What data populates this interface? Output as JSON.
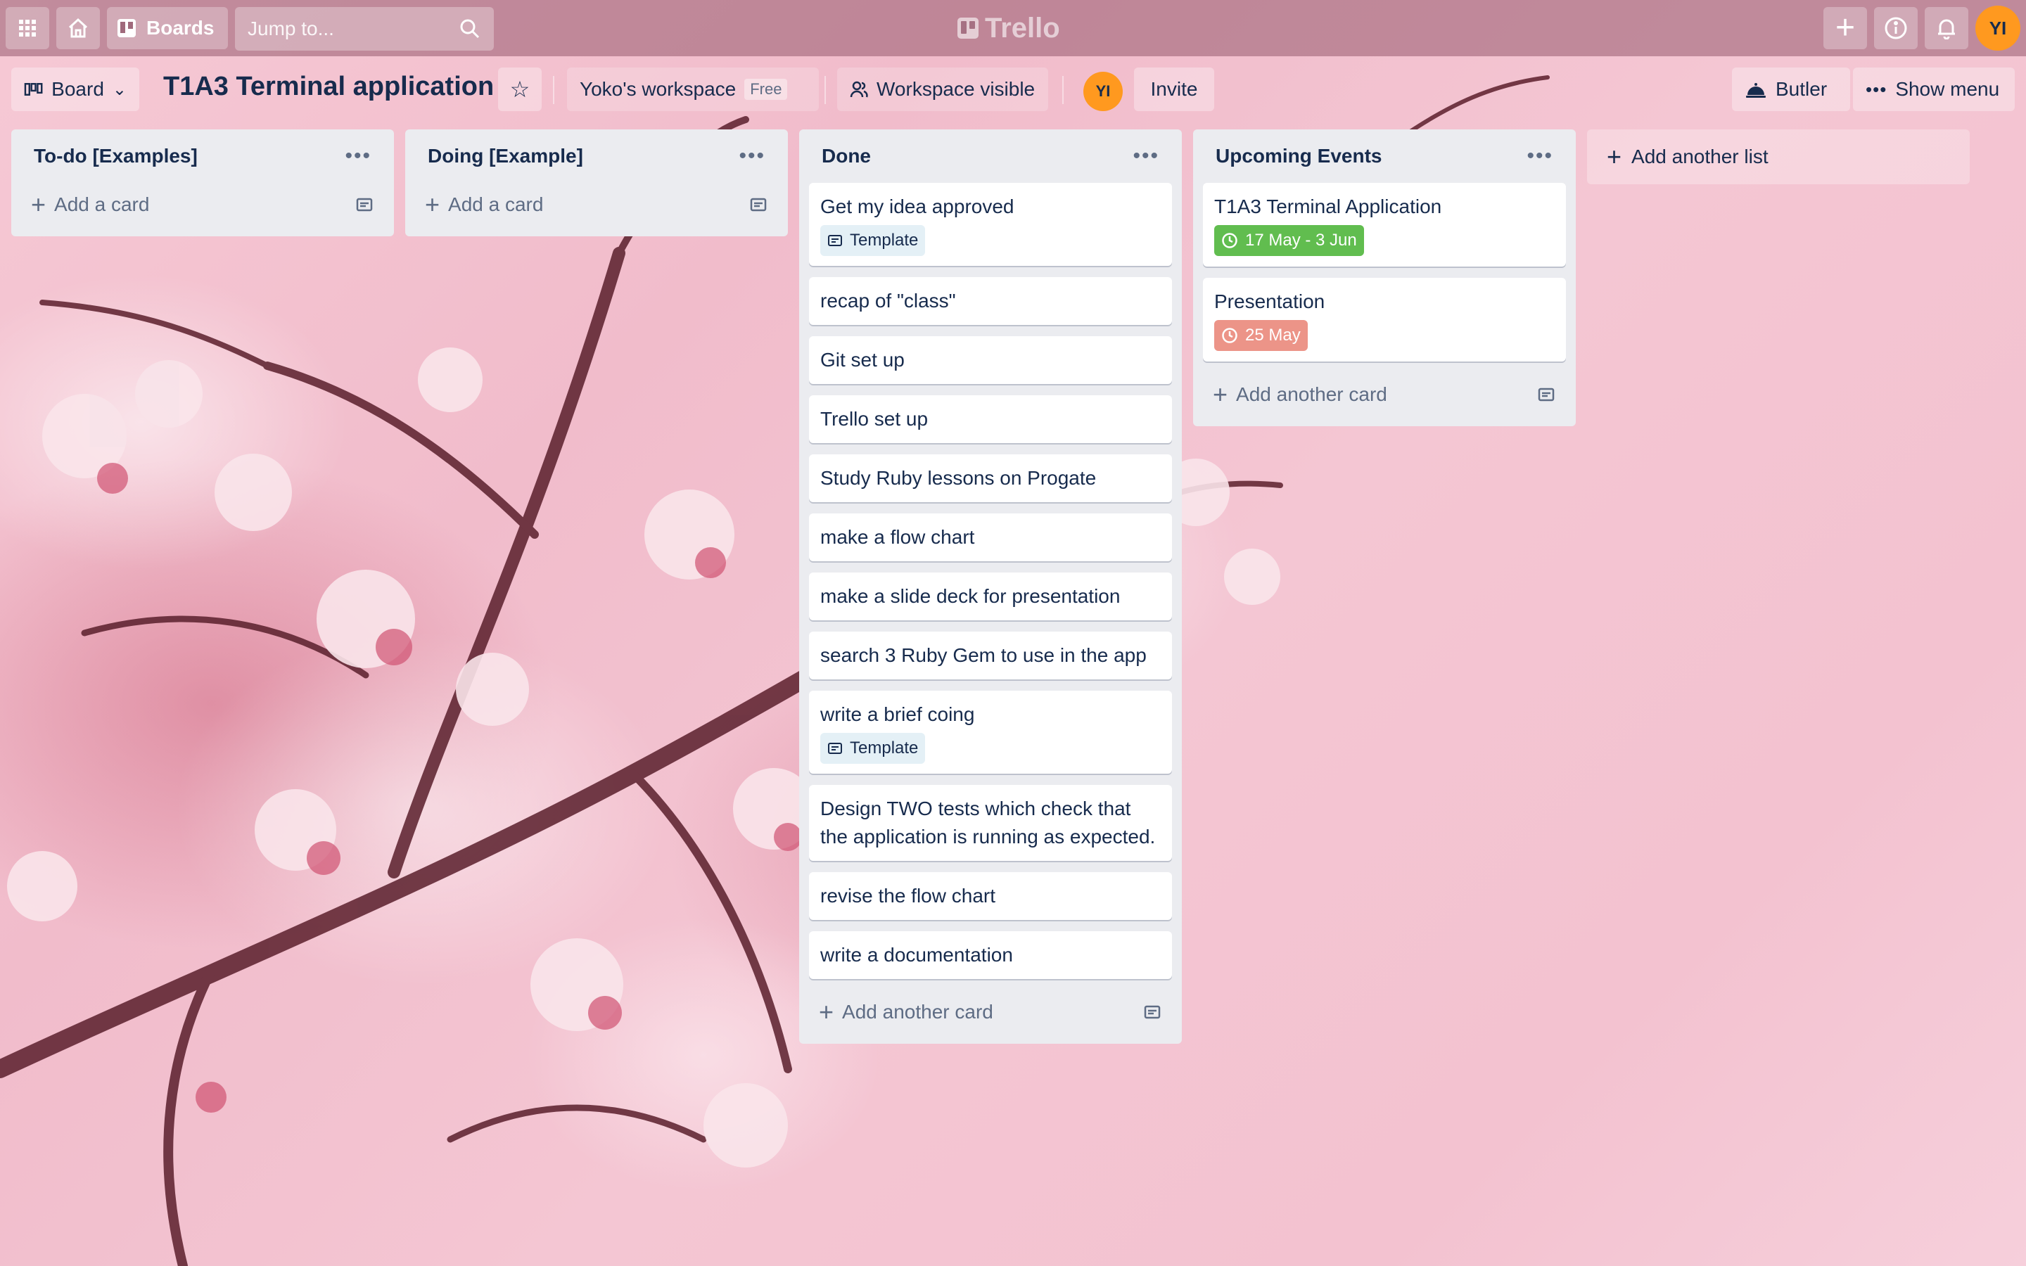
{
  "topbar": {
    "boards_label": "Boards",
    "search_placeholder": "Jump to...",
    "logo_text": "Trello",
    "user_initials": "YI"
  },
  "board": {
    "view_label": "Board",
    "title": "T1A3 Terminal application",
    "workspace_name": "Yoko's workspace",
    "workspace_plan": "Free",
    "visibility_label": "Workspace visible",
    "member_initials": "YI",
    "invite_label": "Invite",
    "butler_label": "Butler",
    "show_menu_label": "Show menu"
  },
  "lists": [
    {
      "title": "To-do [Examples]",
      "cards": [],
      "add_label": "Add a card"
    },
    {
      "title": "Doing [Example]",
      "cards": [],
      "add_label": "Add a card"
    },
    {
      "title": "Done",
      "cards": [
        {
          "title": "Get my idea approved",
          "badge": "Template"
        },
        {
          "title": "recap of \"class\""
        },
        {
          "title": "Git set up"
        },
        {
          "title": "Trello set up"
        },
        {
          "title": "Study Ruby lessons on Progate"
        },
        {
          "title": "make a flow chart"
        },
        {
          "title": "make a slide deck for presentation"
        },
        {
          "title": "search 3 Ruby Gem to use in the app"
        },
        {
          "title": "write a brief coing",
          "badge": "Template"
        },
        {
          "title": "Design TWO tests which check that the application is running as expected."
        },
        {
          "title": "revise the flow chart"
        },
        {
          "title": "write a documentation"
        }
      ],
      "add_label": "Add another card"
    },
    {
      "title": "Upcoming Events",
      "cards": [
        {
          "title": "T1A3 Terminal Application",
          "date": "17 May - 3 Jun"
        },
        {
          "title": "Presentation",
          "date": "25 May"
        }
      ],
      "add_label": "Add another card"
    }
  ],
  "add_list_label": "Add another list",
  "colors": {
    "date_ok": "#61bd4f",
    "date_due": "#ec9488",
    "avatar": "#ff991f",
    "list_bg": "#ebecf0"
  }
}
